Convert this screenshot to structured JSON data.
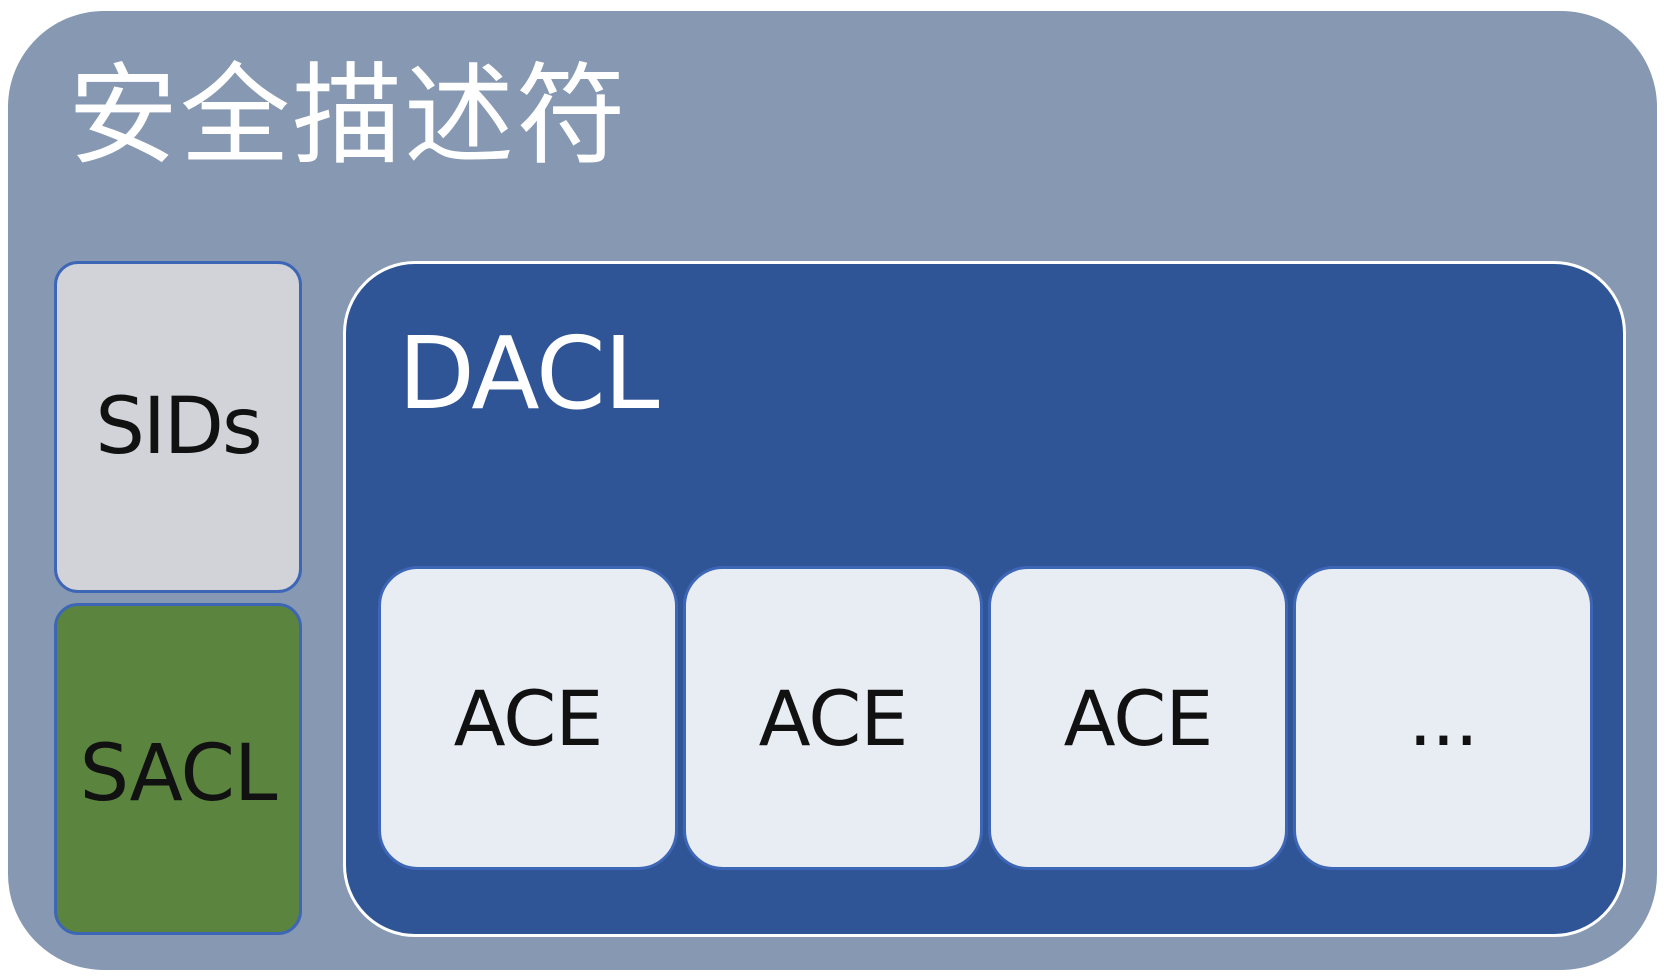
{
  "diagram": {
    "title": "安全描述符",
    "sids_label": "SIDs",
    "sacl_label": "SACL",
    "dacl": {
      "title": "DACL",
      "entries": [
        "ACE",
        "ACE",
        "ACE",
        "..."
      ]
    }
  },
  "colors": {
    "outer_background": "#8698b2",
    "sids_fill": "#d1d3d8",
    "sacl_fill": "#5b843f",
    "dacl_fill": "#2f5596",
    "ace_fill": "#e8edf4",
    "box_border": "#3e66b6"
  }
}
